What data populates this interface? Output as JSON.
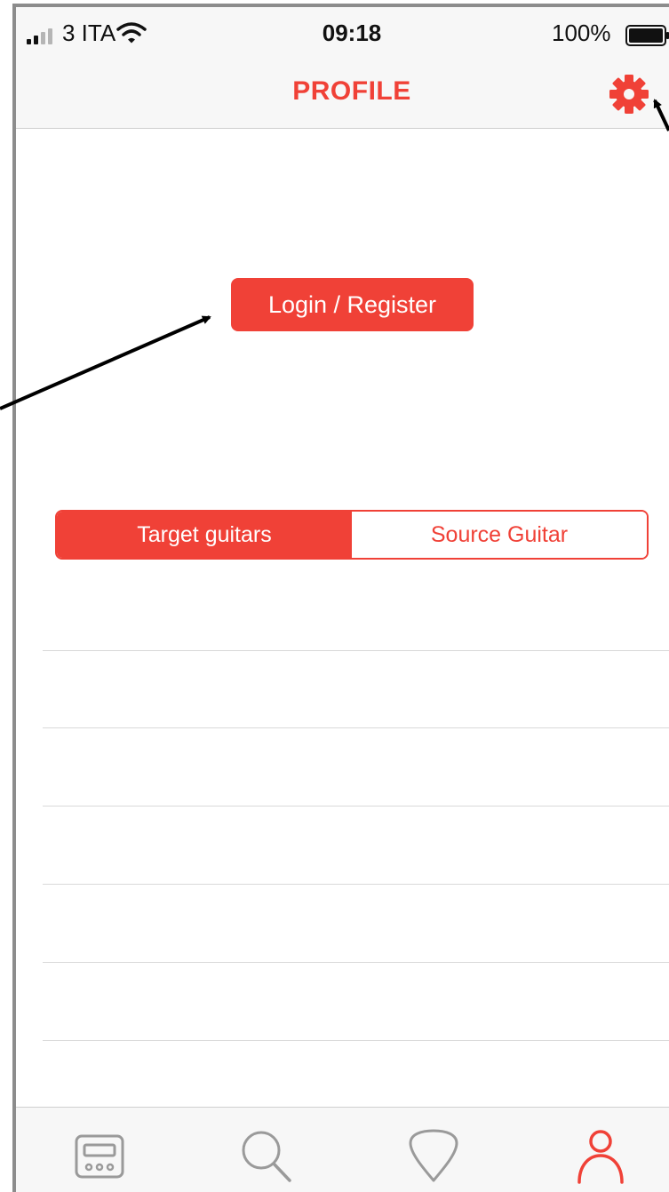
{
  "status_bar": {
    "carrier": "3 ITA",
    "time": "09:18",
    "battery_percent": "100%",
    "signal_icon": "cellular-signal-icon",
    "wifi_icon": "wifi-icon",
    "battery_icon": "battery-full-icon"
  },
  "nav": {
    "title": "PROFILE",
    "settings_icon": "gear-icon"
  },
  "main": {
    "login_label": "Login / Register",
    "segments": [
      {
        "label": "Target guitars",
        "selected": true
      },
      {
        "label": "Source Guitar",
        "selected": false
      }
    ],
    "list_row_count": 6
  },
  "tab_bar": {
    "tabs": [
      {
        "icon": "amplifier-icon",
        "selected": false
      },
      {
        "icon": "search-icon",
        "selected": false
      },
      {
        "icon": "guitar-pick-icon",
        "selected": false
      },
      {
        "icon": "profile-icon",
        "selected": true
      }
    ]
  },
  "colors": {
    "accent": "#f04137",
    "bar_background": "#f7f7f7",
    "inactive_icon": "#9a9a9a",
    "separator": "#d9d9d9"
  }
}
